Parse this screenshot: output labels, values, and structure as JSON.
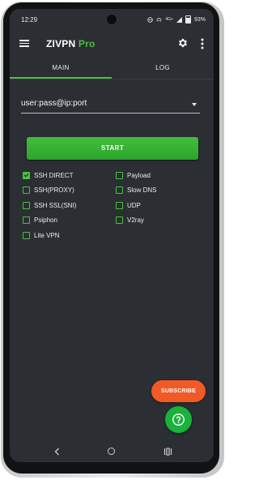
{
  "status_bar": {
    "time": "12:29",
    "network": "4G+",
    "battery": "93%"
  },
  "app_bar": {
    "title": "ZIVPN",
    "title_badge": "Pro",
    "accent_color": "#49c23e"
  },
  "tabs": [
    {
      "label": "MAIN",
      "selected": true
    },
    {
      "label": "LOG",
      "selected": false
    }
  ],
  "server_field": {
    "value": "user:pass@ip:port"
  },
  "start_button": {
    "label": "START"
  },
  "options": {
    "left": [
      {
        "label": "SSH DIRECT",
        "checked": true
      },
      {
        "label": "SSH(PROXY)",
        "checked": false
      },
      {
        "label": "SSH SSL(SNI)",
        "checked": false
      },
      {
        "label": "Psiphon",
        "checked": false
      },
      {
        "label": "Lite VPN",
        "checked": false
      }
    ],
    "right": [
      {
        "label": "Payload",
        "checked": false
      },
      {
        "label": "Slow DNS",
        "checked": false
      },
      {
        "label": "UDP",
        "checked": false
      },
      {
        "label": "V2ray",
        "checked": false
      }
    ]
  },
  "subscribe_button": {
    "label": "SUBSCRIBE",
    "color": "#f15a24"
  },
  "help_fab": {
    "icon": "help-circle-icon",
    "color": "#19b23a"
  },
  "nav_bar": {
    "icons": [
      "back-icon",
      "home-icon",
      "recents-icon"
    ]
  }
}
